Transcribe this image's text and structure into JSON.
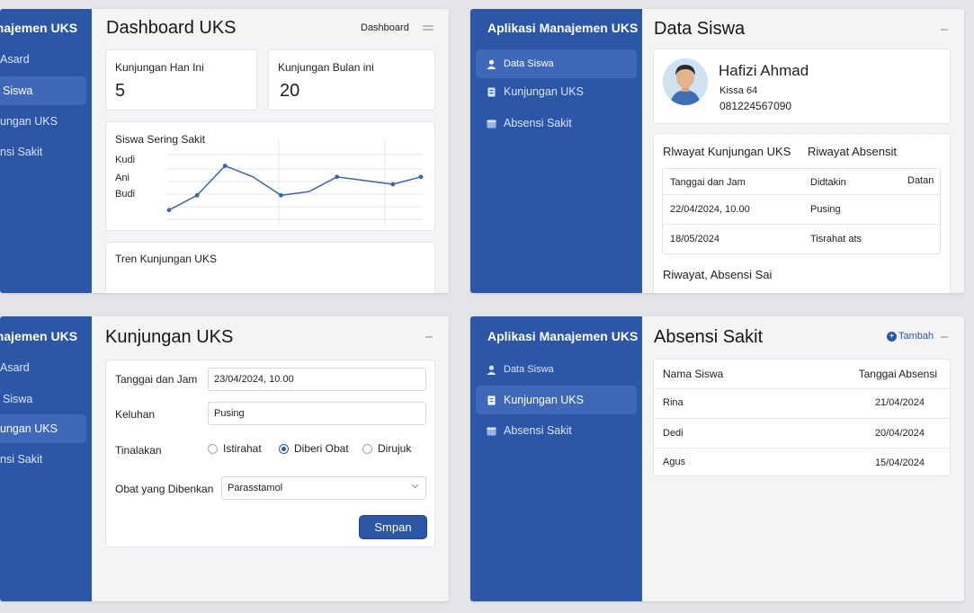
{
  "colors": {
    "sidebar": "#2c56a8",
    "active_item": "#3f68ba",
    "accent": "#2c56a8"
  },
  "panel1": {
    "sidebar_title": "anajemen UKS",
    "nav": [
      {
        "label": "Asard",
        "icon": "dashboard-icon"
      },
      {
        "label": "Siswa",
        "icon": "user-icon"
      },
      {
        "label": "ungan UKS",
        "icon": "clipboard-icon"
      },
      {
        "label": "nsi Sakit",
        "icon": "calendar-icon"
      }
    ],
    "title": "Dashboard UKS",
    "breadcrumb": "Dashboard",
    "stat1_label": "Kunjungan Han Ini",
    "stat1_value": "5",
    "stat2_label": "Kunjungan Bulan ini",
    "stat2_value": "20",
    "chart_title": "Siswa Sering Sakit",
    "trend_title": "Tren Kunjungan UKS"
  },
  "chart_data": {
    "type": "line",
    "title": "Siswa Sering Sakit",
    "y_labels": [
      "Kudi",
      "Ani",
      "Budi"
    ],
    "values": [
      0.15,
      0.35,
      0.75,
      0.6,
      0.35,
      0.4,
      0.6,
      0.55,
      0.5,
      0.6
    ],
    "markers": [
      0,
      1,
      2,
      4,
      6,
      8,
      9
    ],
    "grid": true
  },
  "panel2": {
    "sidebar_title": "Aplikasi Manajemen UKS",
    "nav": [
      {
        "label": "Data Siswa",
        "icon": "user-icon"
      },
      {
        "label": "Kunjungan UKS",
        "icon": "clipboard-icon"
      },
      {
        "label": "Absensi Sakit",
        "icon": "calendar-icon"
      }
    ],
    "title": "Data Siswa",
    "student_name": "Hafizi Ahmad",
    "student_class": "Kissa 64",
    "student_phone": "081224567090",
    "tab1": "Rlwayat Kunjungan UKS",
    "tab2": "Riwayat Absensit",
    "columns": [
      "Tanggai dan Jam",
      "Didtakin",
      "Datan"
    ],
    "rows": [
      [
        "22/04/2024, 10.00",
        "Pusing"
      ],
      [
        "18/05/2024",
        "Tisrahat ats"
      ]
    ],
    "footer": "Riwayat, Absensi Sai"
  },
  "panel3": {
    "sidebar_title": "anajemen UKS",
    "nav": [
      {
        "label": "Asard",
        "icon": "dashboard-icon"
      },
      {
        "label": "Siswa",
        "icon": "user-icon"
      },
      {
        "label": "ungan UKS",
        "icon": "clipboard-icon"
      },
      {
        "label": "nsi Sakit",
        "icon": "calendar-icon"
      }
    ],
    "title": "Kunjungan UKS",
    "f1_label": "Tanggai dan Jam",
    "f1_value": "23/04/2024, 10.00",
    "f2_label": "Keluhan",
    "f2_value": "Pusing",
    "f3_label": "Tinalakan",
    "radios": [
      "Istirahat",
      "Diberi Obat",
      "Dirujuk"
    ],
    "selected": "Diberi Obat",
    "f4_label": "Obat yang Dibenkan",
    "f4_value": "Parasstamol",
    "save": "Smpan"
  },
  "panel4": {
    "sidebar_title": "Aplikasi Manajemen UKS",
    "nav": [
      {
        "label": "Data Siswa",
        "icon": "user-icon"
      },
      {
        "label": "Kunjungan UKS",
        "icon": "clipboard-icon"
      },
      {
        "label": "Absensi Sakit",
        "icon": "calendar-icon"
      }
    ],
    "title": "Absensi Sakit",
    "add": "Tambah",
    "columns": [
      "Nama Siswa",
      "Tanggai Absensi"
    ],
    "rows": [
      [
        "Rina",
        "21/04/2024"
      ],
      [
        "Dedi",
        "20/04/2024"
      ],
      [
        "Agus",
        "15/04/2024"
      ]
    ]
  }
}
